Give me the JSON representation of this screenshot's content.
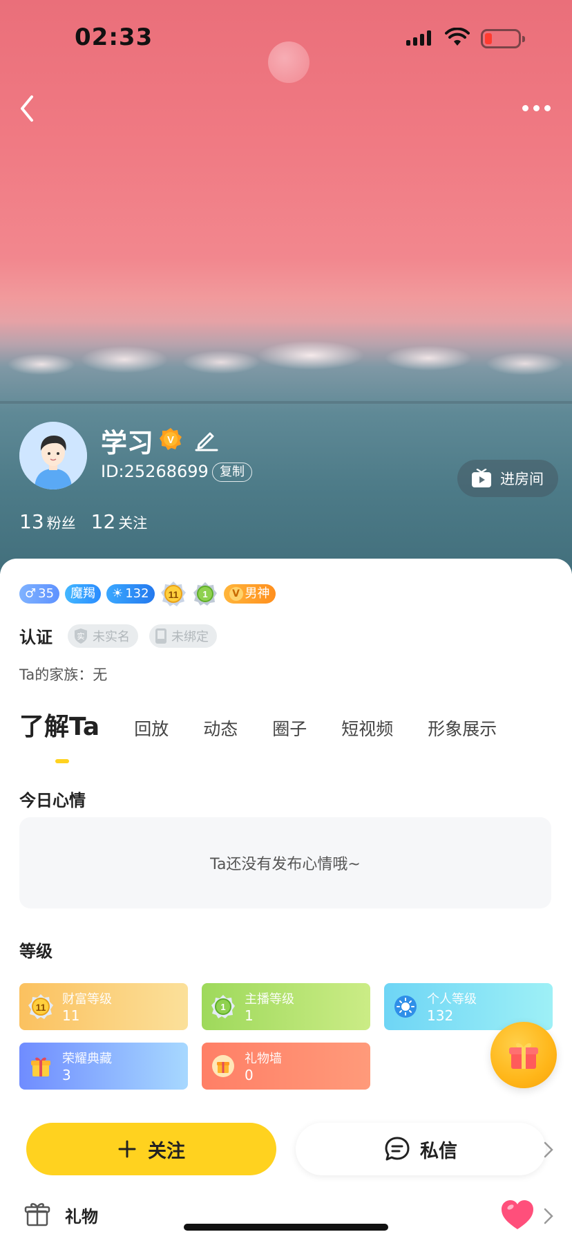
{
  "status_bar": {
    "time": "02:33"
  },
  "profile": {
    "name": "学习",
    "id_text": "ID:25268699",
    "copy_label": "复制",
    "enter_room_label": "进房间",
    "fans_count": "13",
    "fans_label": "粉丝",
    "following_count": "12",
    "following_label": "关注"
  },
  "badges": {
    "gender_level": "35",
    "mohe_label": "魔羯",
    "sun_level": "132",
    "wealth_medal": "11",
    "anchor_medal": "1",
    "vip_label": "男神"
  },
  "certification": {
    "title": "认证",
    "realname_label": "未实名",
    "phone_label": "未绑定",
    "realname_icon_char": "实"
  },
  "family_text": "Ta的家族：无",
  "tabs": [
    {
      "label": "了解Ta"
    },
    {
      "label": "回放"
    },
    {
      "label": "动态"
    },
    {
      "label": "圈子"
    },
    {
      "label": "短视频"
    },
    {
      "label": "形象展示"
    }
  ],
  "mood": {
    "title": "今日心情",
    "empty_text": "Ta还没有发布心情哦~"
  },
  "levels": {
    "title": "等级",
    "items": [
      {
        "label": "财富等级",
        "value": "11",
        "icon_value": "11",
        "color": "#fbc15f"
      },
      {
        "label": "主播等级",
        "value": "1",
        "icon_value": "1",
        "color": "#9ed95b"
      },
      {
        "label": "个人等级",
        "value": "132",
        "color": "#6ed5f5"
      },
      {
        "label": "荣耀典藏",
        "value": "3",
        "color": "#6f8cff"
      },
      {
        "label": "礼物墙",
        "value": "0",
        "color": "#ff7f66"
      }
    ]
  },
  "actions": {
    "follow_label": "关注",
    "message_label": "私信"
  },
  "gifts_row": {
    "label": "礼物"
  }
}
